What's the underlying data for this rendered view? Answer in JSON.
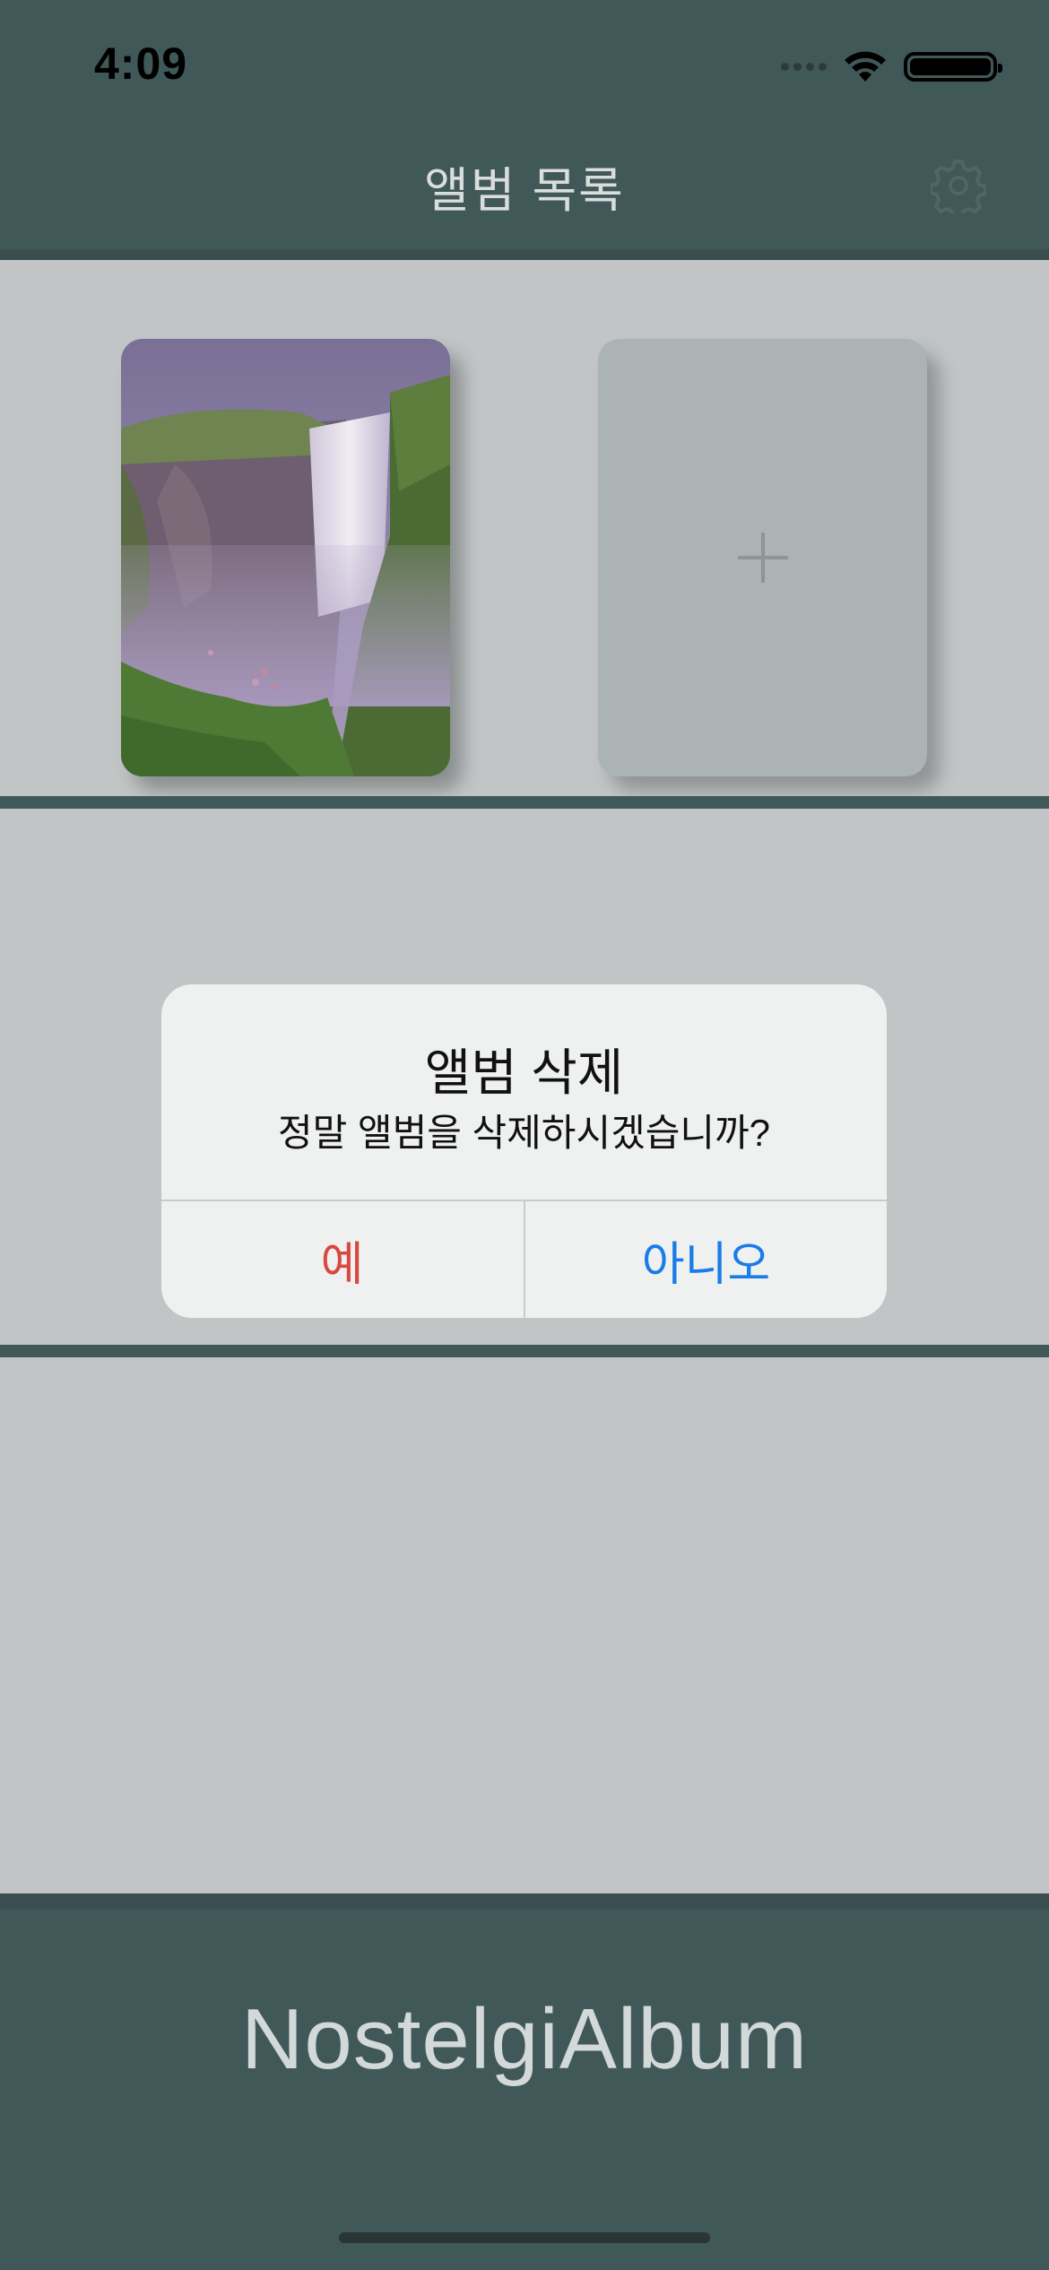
{
  "status_bar": {
    "time": "4:09"
  },
  "nav": {
    "title": "앨범 목록",
    "settings_icon": "gear-icon"
  },
  "albums": [
    {
      "type": "photo",
      "subject": "waterfall"
    },
    {
      "type": "add",
      "icon": "plus-icon"
    }
  ],
  "alert": {
    "title": "앨범 삭제",
    "message": "정말 앨범을 삭제하시겠습니까?",
    "yes_label": "예",
    "no_label": "아니오",
    "yes_color": "#d9483e",
    "no_color": "#1a7ce8"
  },
  "footer": {
    "app_name": "NostelgiAlbum"
  },
  "colors": {
    "header_bg": "#415859",
    "shelf_bg": "#c1c5c6",
    "add_card_bg": "#acb3b4"
  }
}
